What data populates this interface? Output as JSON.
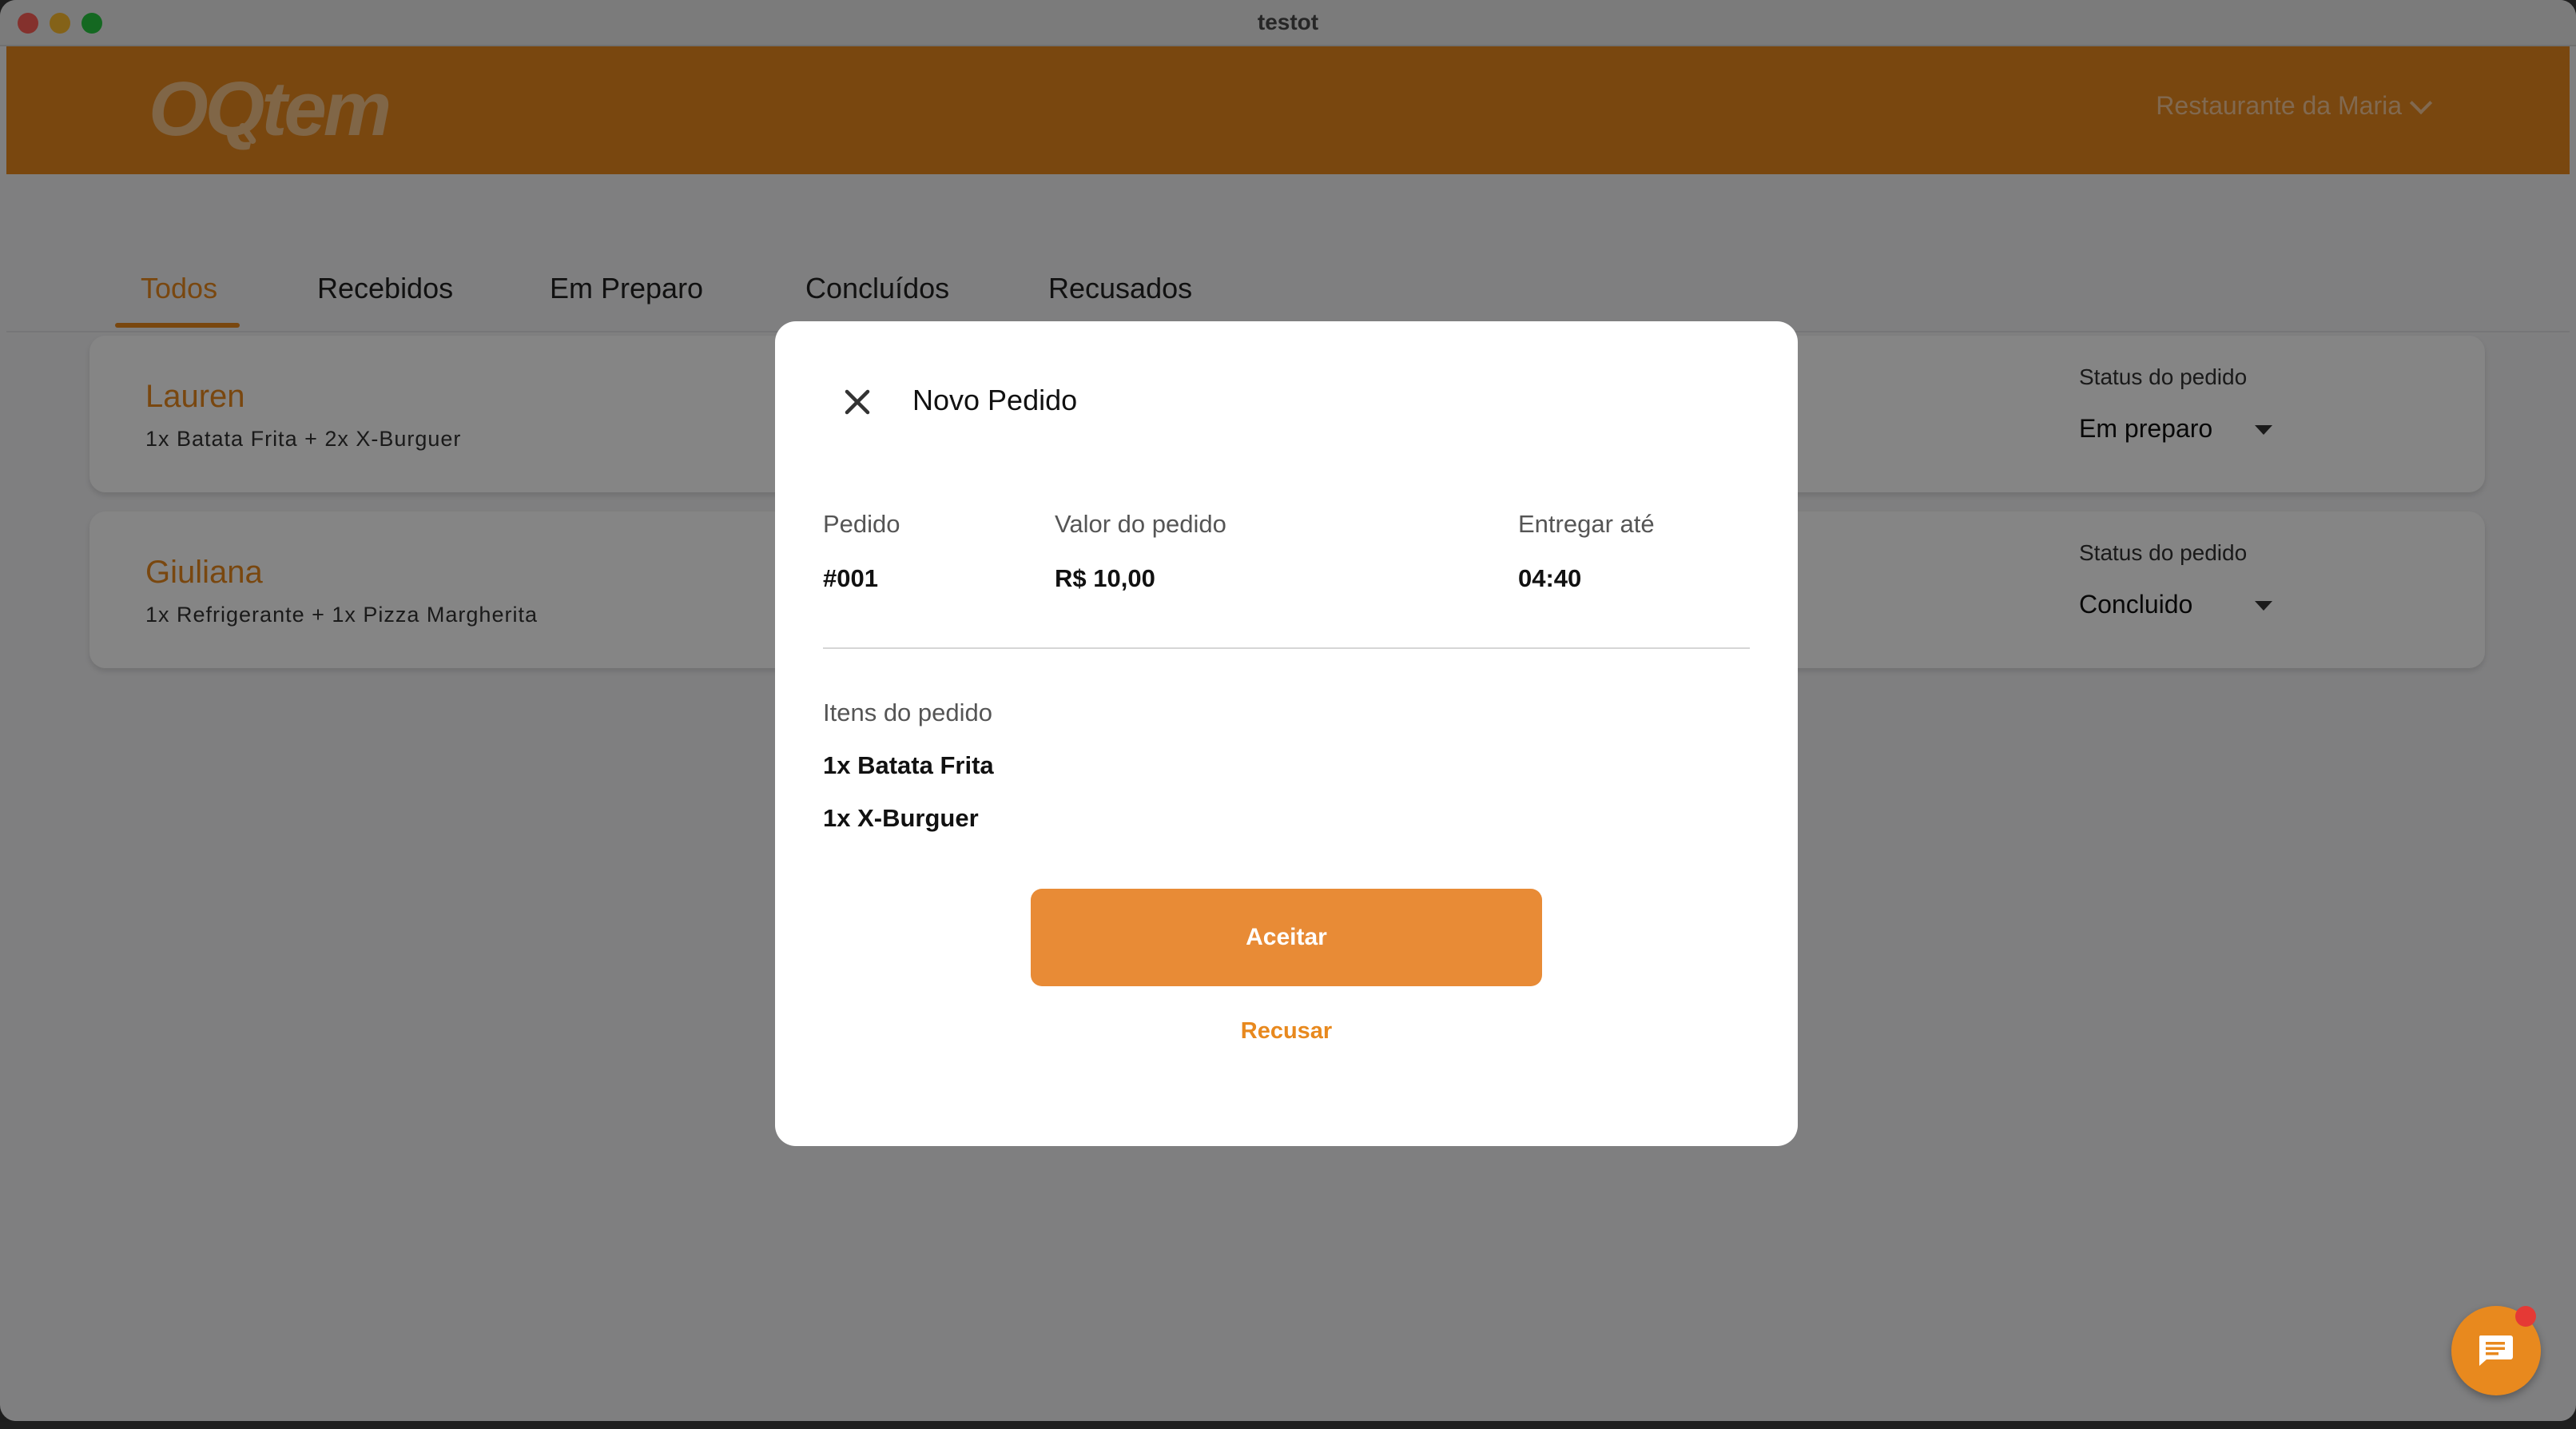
{
  "window": {
    "title": "testot"
  },
  "header": {
    "logo_text": "OQtem",
    "restaurant_selector": "Restaurante da Maria"
  },
  "tabs": [
    {
      "label": "Todos",
      "active": true
    },
    {
      "label": "Recebidos",
      "active": false
    },
    {
      "label": "Em Preparo",
      "active": false
    },
    {
      "label": "Concluídos",
      "active": false
    },
    {
      "label": "Recusados",
      "active": false
    }
  ],
  "orders": [
    {
      "customer": "Lauren",
      "items": "1x Batata Frita + 2x X-Burguer",
      "status_label": "Status do pedido",
      "status": "Em preparo"
    },
    {
      "customer": "Giuliana",
      "items": "1x Refrigerante + 1x Pizza Margherita",
      "status_label": "Status do pedido",
      "status": "Concluido"
    }
  ],
  "modal": {
    "title": "Novo Pedido",
    "order_label": "Pedido",
    "order_value": "#001",
    "amount_label": "Valor do pedido",
    "amount_value": "R$ 10,00",
    "deliver_label": "Entregar até",
    "deliver_value": "04:40",
    "items_label": "Itens do pedido",
    "items": [
      "1x Batata Frita",
      "1x X-Burguer"
    ],
    "accept_label": "Aceitar",
    "refuse_label": "Recusar"
  },
  "colors": {
    "brand": "#e8891e",
    "accept_button": "#e88b36",
    "badge": "#e53935"
  },
  "icons": {
    "close": "close-icon",
    "dropdown": "chevron-down-icon",
    "chat": "chat-icon"
  }
}
